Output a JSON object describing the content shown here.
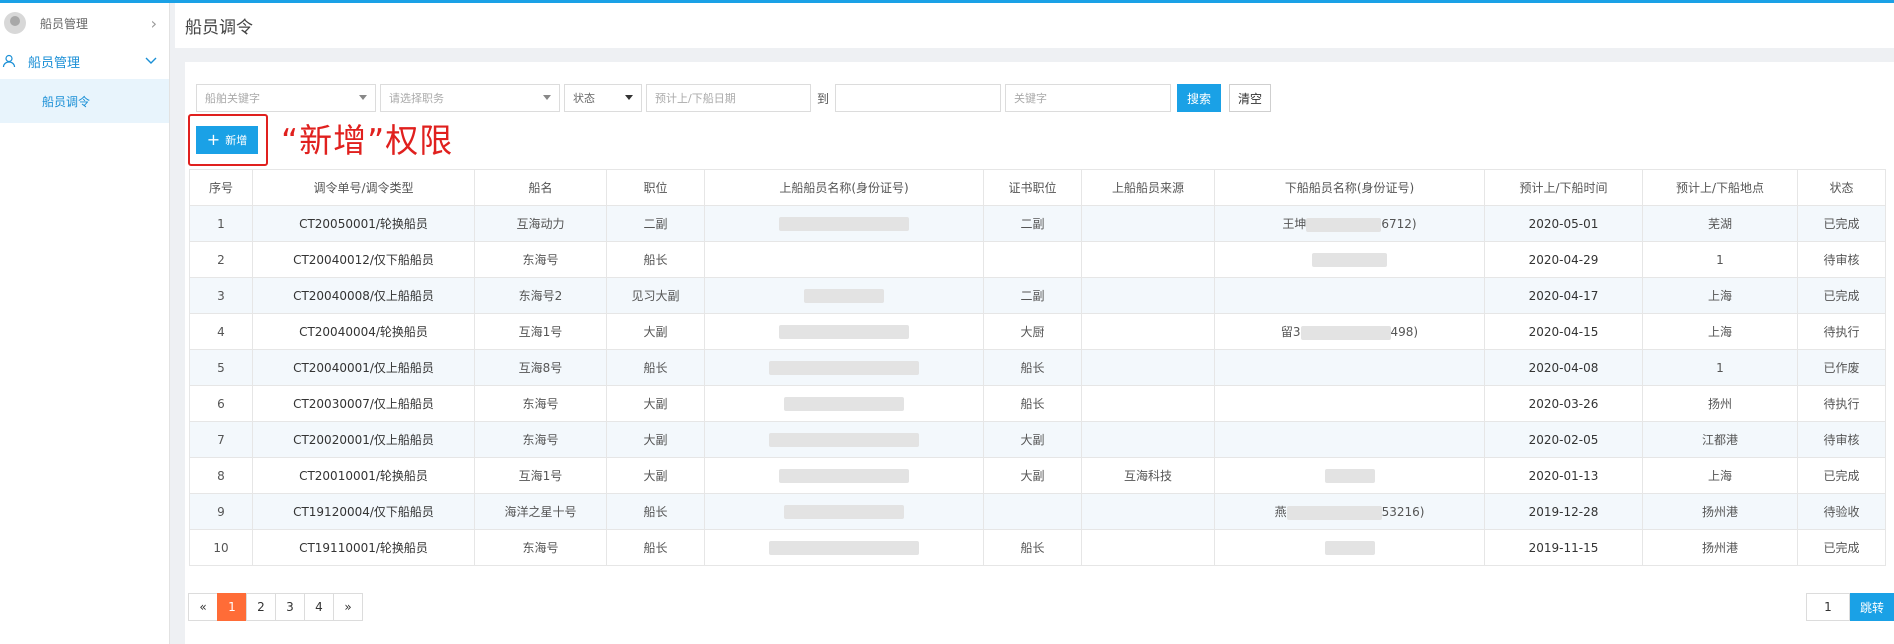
{
  "sidebar": {
    "top_label": "船员管理",
    "group_label": "船员管理",
    "active_item": "船员调令"
  },
  "header": {
    "title": "船员调令"
  },
  "filters": {
    "ship_keyword": "船舶关键字",
    "position": "请选择职务",
    "status": "状态",
    "date_start": "预计上/下船日期",
    "to_label": "到",
    "keyword": "关键字",
    "search": "搜索",
    "clear": "清空"
  },
  "add_button": "新增",
  "annotation": "“新增”权限",
  "columns": [
    "序号",
    "调令单号/调令类型",
    "船名",
    "职位",
    "上船船员名称(身份证号)",
    "证书职位",
    "上船船员来源",
    "下船船员名称(身份证号)",
    "预计上/下船时间",
    "预计上/下船地点",
    "状态"
  ],
  "rows": [
    {
      "no": "1",
      "order": "CT20050001/轮换船员",
      "ship": "互海动力",
      "pos": "二副",
      "on": "",
      "cert": "二副",
      "source": "",
      "off": "王坤",
      "off_tail": "6712)",
      "date": "2020-05-01",
      "place": "芜湖",
      "status": "已完成"
    },
    {
      "no": "2",
      "order": "CT20040012/仅下船船员",
      "ship": "东海号",
      "pos": "船长",
      "on": "",
      "cert": "",
      "source": "",
      "off": "",
      "off_tail": "",
      "date": "2020-04-29",
      "place": "1",
      "status": "待审核"
    },
    {
      "no": "3",
      "order": "CT20040008/仅上船船员",
      "ship": "东海号2",
      "pos": "见习大副",
      "on": "",
      "cert": "二副",
      "source": "",
      "off": "",
      "off_tail": "",
      "date": "2020-04-17",
      "place": "上海",
      "status": "已完成"
    },
    {
      "no": "4",
      "order": "CT20040004/轮换船员",
      "ship": "互海1号",
      "pos": "大副",
      "on": "",
      "cert": "大厨",
      "source": "",
      "off": "留3",
      "off_tail": "498)",
      "date": "2020-04-15",
      "place": "上海",
      "status": "待执行"
    },
    {
      "no": "5",
      "order": "CT20040001/仅上船船员",
      "ship": "互海8号",
      "pos": "船长",
      "on": "",
      "cert": "船长",
      "source": "",
      "off": "",
      "off_tail": "",
      "date": "2020-04-08",
      "place": "1",
      "status": "已作废"
    },
    {
      "no": "6",
      "order": "CT20030007/仅上船船员",
      "ship": "东海号",
      "pos": "大副",
      "on": "",
      "cert": "船长",
      "source": "",
      "off": "",
      "off_tail": "",
      "date": "2020-03-26",
      "place": "扬州",
      "status": "待执行"
    },
    {
      "no": "7",
      "order": "CT20020001/仅上船船员",
      "ship": "东海号",
      "pos": "大副",
      "on": "",
      "cert": "大副",
      "source": "",
      "off": "",
      "off_tail": "",
      "date": "2020-02-05",
      "place": "江都港",
      "status": "待审核"
    },
    {
      "no": "8",
      "order": "CT20010001/轮换船员",
      "ship": "互海1号",
      "pos": "大副",
      "on": "",
      "cert": "大副",
      "source": "互海科技",
      "off": "",
      "off_tail": "",
      "date": "2020-01-13",
      "place": "上海",
      "status": "已完成"
    },
    {
      "no": "9",
      "order": "CT19120004/仅下船船员",
      "ship": "海洋之星十号",
      "pos": "船长",
      "on": "",
      "cert": "",
      "source": "",
      "off": "燕",
      "off_tail": "53216)",
      "date": "2019-12-28",
      "place": "扬州港",
      "status": "待验收"
    },
    {
      "no": "10",
      "order": "CT19110001/轮换船员",
      "ship": "东海号",
      "pos": "船长",
      "on": "",
      "cert": "船长",
      "source": "",
      "off": "",
      "off_tail": "",
      "date": "2019-11-15",
      "place": "扬州港",
      "status": "已完成"
    }
  ],
  "pagination": {
    "prev": "«",
    "pages": [
      "1",
      "2",
      "3",
      "4"
    ],
    "current": "1",
    "next": "»"
  },
  "jump": {
    "value": "1",
    "label": "跳转"
  },
  "colors": {
    "accent": "#1aa1e6",
    "active_page": "#ff6c37",
    "annotation": "#e0201e"
  }
}
